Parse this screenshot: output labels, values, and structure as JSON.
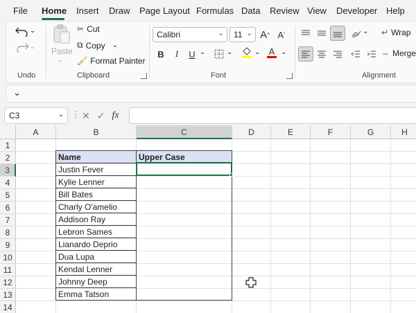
{
  "menu": {
    "items": [
      "File",
      "Home",
      "Insert",
      "Draw",
      "Page Layout",
      "Formulas",
      "Data",
      "Review",
      "View",
      "Developer",
      "Help"
    ],
    "active": "Home"
  },
  "ribbon": {
    "undo_group": {
      "label": "Undo"
    },
    "clipboard_group": {
      "label": "Clipboard",
      "paste": "Paste",
      "cut": "Cut",
      "copy": "Copy",
      "format_painter": "Format Painter"
    },
    "font_group": {
      "label": "Font",
      "font_name": "Calibri",
      "font_size": "11",
      "bold": "B",
      "italic": "I",
      "underline": "U",
      "font_color_letter": "A"
    },
    "alignment_group": {
      "label": "Alignment",
      "wrap": "Wrap",
      "merge": "Merge"
    }
  },
  "formula_bar": {
    "name_box": "C3",
    "fx": "fx",
    "formula": ""
  },
  "grid": {
    "columns": [
      "A",
      "B",
      "C",
      "D",
      "E",
      "F",
      "G",
      "H"
    ],
    "selected_column": "C",
    "rows": [
      "1",
      "2",
      "3",
      "4",
      "5",
      "6",
      "7",
      "8",
      "9",
      "10",
      "11",
      "12",
      "13",
      "14"
    ],
    "selected_row": "3"
  },
  "table": {
    "headers": [
      "Name",
      "Upper Case"
    ],
    "names": [
      "Justin Fever",
      "Kylie Lenner",
      "Bill Bates",
      "Charly O'amelio",
      "Addison Ray",
      "Lebron Sames",
      "Lianardo Deprio",
      "Dua Lupa",
      "Kendal Lenner",
      "Johnny Deep",
      "Emma Tatson"
    ]
  },
  "colors": {
    "accent": "#1e7145",
    "header_fill": "#d9e1f2"
  }
}
